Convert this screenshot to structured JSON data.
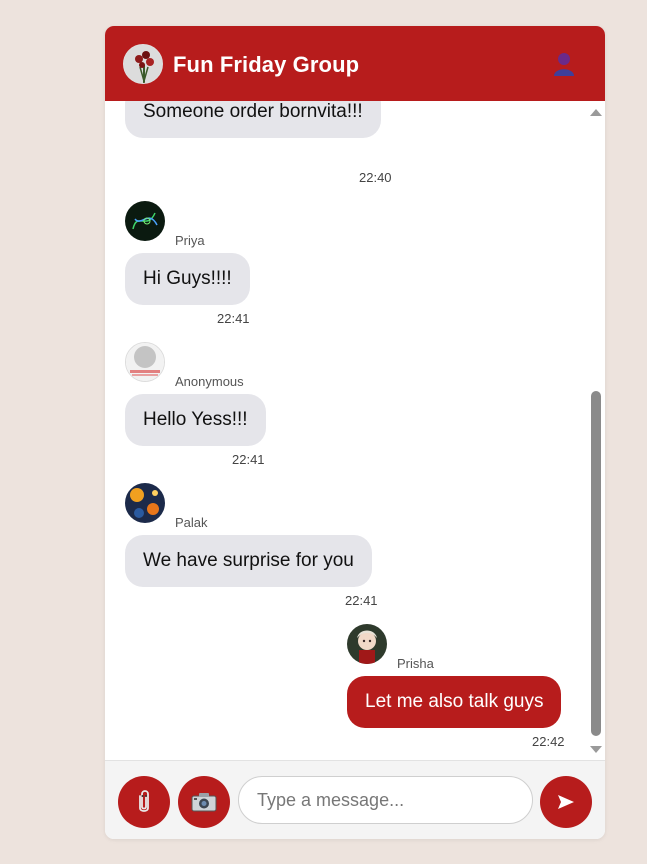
{
  "header": {
    "title": "Fun Friday Group",
    "group_avatar_icon": "bouquet-avatar",
    "user_icon": "user-icon",
    "accent_color": "#b71c1c"
  },
  "messages": [
    {
      "sender": "",
      "text": "Someone order bornvita!!!",
      "time": "22:40",
      "mine": false
    },
    {
      "sender": "Priya",
      "text": "Hi Guys!!!!",
      "time": "22:41",
      "mine": false
    },
    {
      "sender": "Anonymous",
      "text": "Hello Yess!!!",
      "time": "22:41",
      "mine": false
    },
    {
      "sender": "Palak",
      "text": "We have surprise for you",
      "time": "22:41",
      "mine": false
    },
    {
      "sender": "Prisha",
      "text": "Let me also talk guys",
      "time": "22:42",
      "mine": true
    }
  ],
  "composer": {
    "attach_icon": "paperclip-icon",
    "camera_icon": "camera-icon",
    "placeholder": "Type a message...",
    "value": "",
    "send_icon": "send-icon"
  }
}
